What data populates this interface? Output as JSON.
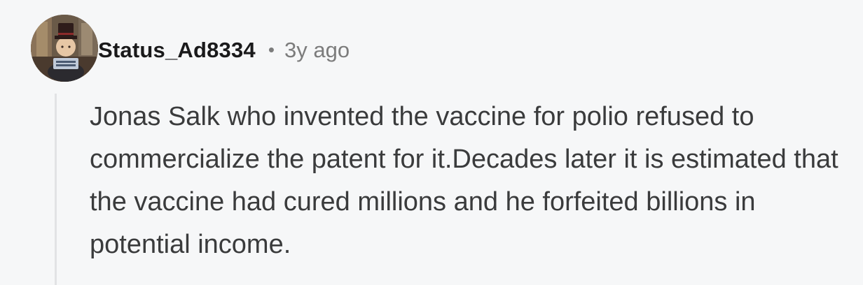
{
  "comment": {
    "username": "Status_Ad8334",
    "separator": "•",
    "timestamp": "3y ago",
    "body": "Jonas Salk who invented the vaccine for polio refused to commercialize the patent for it.Decades later it is estimated that the vaccine had cured millions and he forfeited billions in potential income."
  },
  "avatar": {
    "icon": "user-avatar-icon"
  }
}
